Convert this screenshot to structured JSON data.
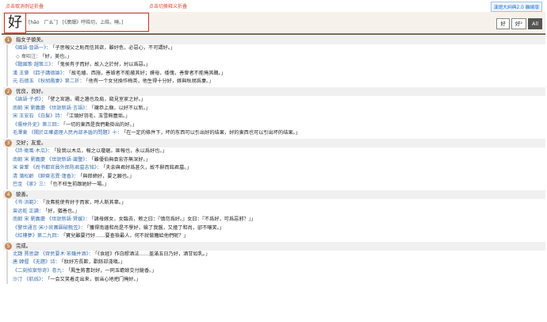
{
  "hints": {
    "left": "点击取消例证折叠",
    "mid": "点击切换释义折叠"
  },
  "dict_link": "漢語大詞典2.0 離線版",
  "headword": "好",
  "pron": {
    "pinyin": "[hǎo　ㄏㄠˇ]",
    "source": "[《廣韻》呼皓切，上皓，曉。]"
  },
  "mode_buttons": [
    "好",
    "好²",
    "All"
  ],
  "senses": [
    {
      "num": "1",
      "def": "指女子貌美。",
      "examples": [
        {
          "src": "《國語·晉語一》：",
          "quote": "「子思報父之恥而信其欲，雖好色，必惡心，不可謂好。」"
        },
        {
          "src": "◇ 韋昭注：",
          "quote": "「好，美也。」",
          "note": true
        },
        {
          "src": "《戰國策·趙策三》：",
          "quote": "「鬼侯有子而好，故入之於紂，紂以爲惡。」"
        },
        {
          "src": "漢 王褒 《四子講德論》：",
          "quote": "「故毛嬙、西施，善毀者不能蔽其好；嫫母、倭傀，善譽者不能掩其醜。」"
        },
        {
          "src": "元 石德玉 《秋胡戲妻》第二折：",
          "quote": "「他有一个女兒換作梅英，他生得十分好，嫁與秋胡爲妻。」"
        }
      ]
    },
    {
      "num": "2",
      "def": "优良，良好。",
      "examples": [
        {
          "src": "《論語·子張》：",
          "quote": "「譬之宮牆，賜之牆也及肩，窺見室家之好。」"
        },
        {
          "src": "南朝 宋 劉義慶 《世說新語·言語》：",
          "quote": "「襪恭上廟，以好不以新。」"
        },
        {
          "src": "宋 王安石 《白髮》詩：",
          "quote": "「江頭好羽毛，玉雪無塵垢。」"
        },
        {
          "src": "《儒林外史》第三回：",
          "quote": "「一切的東西是我們動掛出的好。」"
        },
        {
          "src": "毛澤東 《關於正確處理人民內部矛盾的問題》十：",
          "quote": "「在一定的條件下，坏的东西可以引出好的结果，好的東西也可以引出坏的结果。」"
        }
      ]
    },
    {
      "num": "3",
      "def": "交好；友爱。",
      "examples": [
        {
          "src": "《詩·衛風·木瓜》：",
          "quote": "「投我以木瓜，報之以瓊琚。匪報也，永以爲好也。」"
        },
        {
          "src": "南朝 宋 劉義慶 《世說新語·識鑒》：",
          "quote": "「雖優伯與袁宏亦無深好。」"
        },
        {
          "src": "宋 曾鞏 《尚书都官員外郎陈君墓志铭》：",
          "quote": "「夫余與君好爲甚久，故不辭而銘君墓。」"
        },
        {
          "src": "清 蒲松齡 《聊齋志異·蓮香》：",
          "quote": "「與郎締好，要之願也。」"
        },
        {
          "src": "巴金 《家》三：",
          "quote": "「也不枉生前跟她好一場。」"
        }
      ]
    },
    {
      "num": "4",
      "def": "貌善。",
      "examples": [
        {
          "src": "《书·洪範》：",
          "quote": "「汝弗能使有好于而家，時人斯其辜。」"
        },
        {
          "src": "曾运乾 正讀：",
          "quote": "「好，猶善也。」"
        },
        {
          "src": "南朝 宋 劉義慶 《世說新語·賢媛》：",
          "quote": "「諸母嫁女，女臨去，敕之曰：『慎勿爲好。』女曰：『不爲好，可爲惡邪？』」"
        },
        {
          "src": "《警世通言·宋小官團圓破氈笠》：",
          "quote": "「獲得南邊和尚是不學好，躲了我盤，又撞了和尚，卻不嚷笑。」"
        },
        {
          "src": "《紅樓夢》第二九回：",
          "quote": "「寶兒雖要行好……要查檢最人，何不就做籬給他們呢？」"
        }
      ]
    },
    {
      "num": "5",
      "def": "完成。",
      "examples": [
        {
          "src": "北魏 賈思勰 《齊民要术·笨麯并酒》：",
          "quote": "「《食經》作白醪酒法……盖滿五日乃好，酒甘如乳。」"
        },
        {
          "src": "唐 韓偓 《无題》诗：",
          "quote": "「妝好方長歎，歡餘却淺嗔。」"
        },
        {
          "src": "《二刻拍案惊奇》卷九：",
          "quote": "「鳳生將書封好，一同玉蟾蜍交付龍香。」"
        },
        {
          "src": "沙汀 《航线》：",
          "quote": "「一会又笑着走出来，很当心地把门掩好。」"
        }
      ]
    }
  ]
}
